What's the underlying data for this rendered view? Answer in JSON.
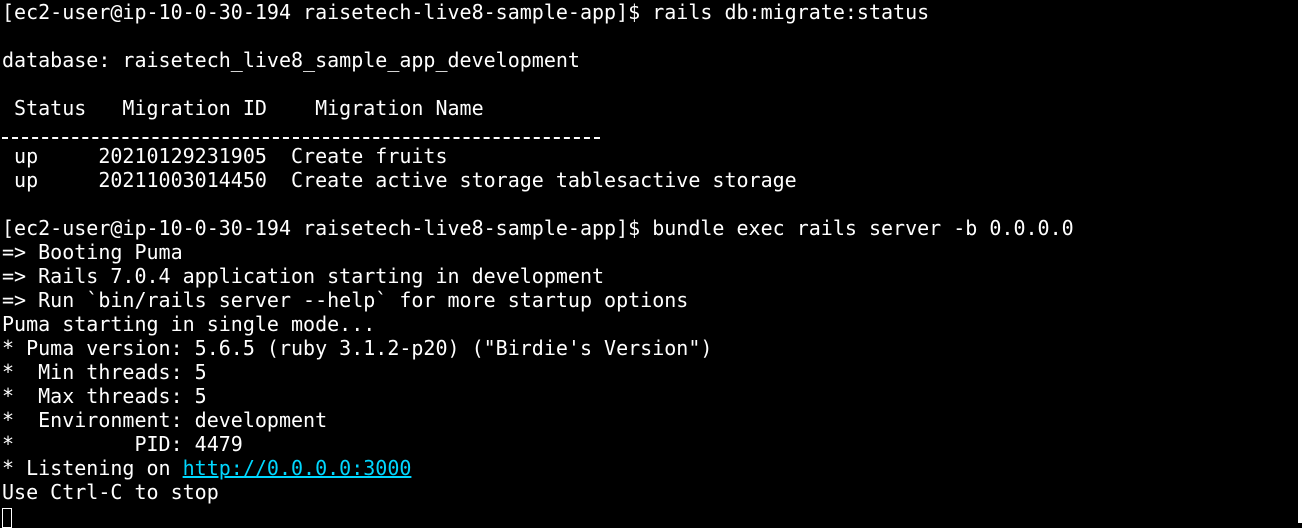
{
  "terminal": {
    "prompt1": "[ec2-user@ip-10-0-30-194 raisetech-live8-sample-app]$ rails db:migrate:status",
    "database_line": "database: raisetech_live8_sample_app_development",
    "table_header": " Status   Migration ID    Migration Name",
    "migrations": [
      " up     20210129231905  Create fruits",
      " up     20211003014450  Create active storage tablesactive storage"
    ],
    "prompt2": "[ec2-user@ip-10-0-30-194 raisetech-live8-sample-app]$ bundle exec rails server -b 0.0.0.0",
    "boot_lines": [
      "=> Booting Puma",
      "=> Rails 7.0.4 application starting in development",
      "=> Run `bin/rails server --help` for more startup options",
      "Puma starting in single mode...",
      "* Puma version: 5.6.5 (ruby 3.1.2-p20) (\"Birdie's Version\")",
      "*  Min threads: 5",
      "*  Max threads: 5",
      "*  Environment: development",
      "*          PID: 4479"
    ],
    "listening_prefix": "* Listening on ",
    "listening_url": "http://0.0.0.0:3000",
    "stop_line": "Use Ctrl-C to stop"
  }
}
